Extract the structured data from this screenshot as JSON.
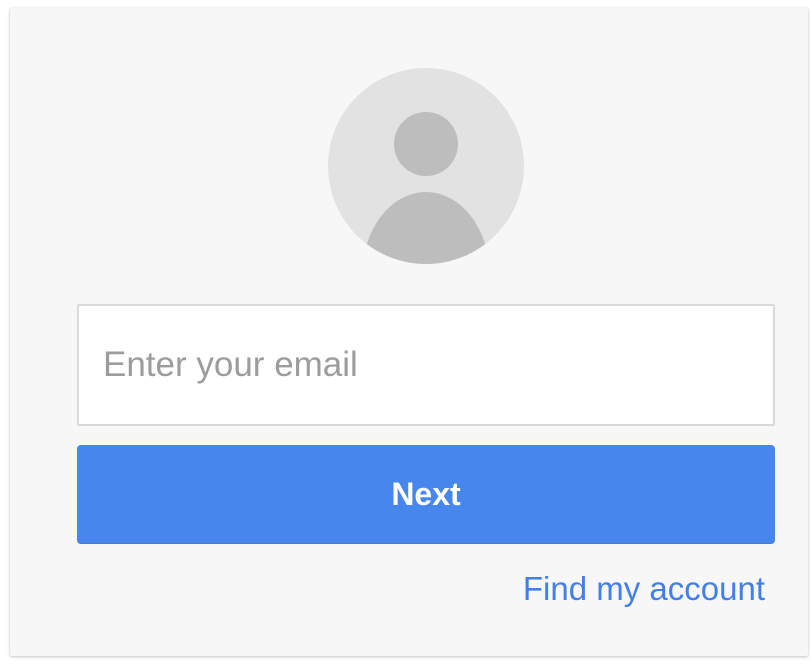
{
  "login": {
    "avatar_icon": "default-user-avatar-icon",
    "email_placeholder": "Enter your email",
    "email_value": "",
    "next_label": "Next",
    "find_account_label": "Find my account"
  },
  "colors": {
    "card_background": "#f7f7f7",
    "avatar_background": "#e2e2e2",
    "avatar_silhouette": "#bdbdbd",
    "primary_button": "#4787ed",
    "link": "#427fed",
    "placeholder_text": "#9c9c9c"
  }
}
